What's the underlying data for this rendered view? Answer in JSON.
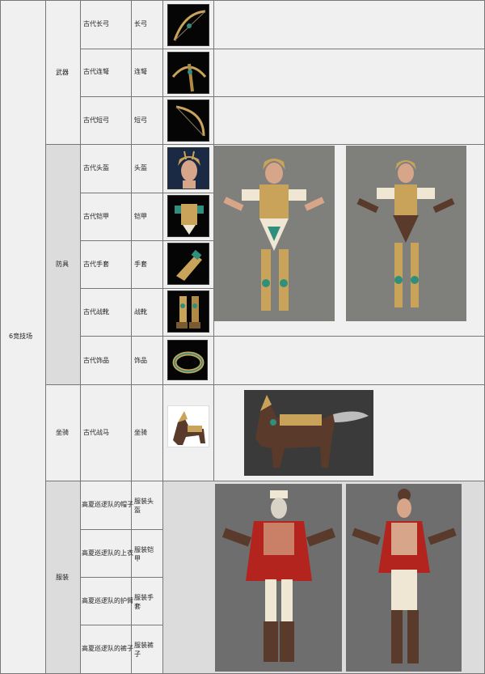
{
  "section": "6竞技场",
  "groups": [
    {
      "label": "武器"
    },
    {
      "label": "防具"
    },
    {
      "label": "坐骑"
    },
    {
      "label": "服装"
    }
  ],
  "rows": [
    {
      "item": "古代长弓",
      "type": "长弓",
      "icon": "longbow-icon"
    },
    {
      "item": "古代连弩",
      "type": "连弩",
      "icon": "crossbow-icon"
    },
    {
      "item": "古代短弓",
      "type": "短弓",
      "icon": "shortbow-icon"
    },
    {
      "item": "古代头盔",
      "type": "头盔",
      "icon": "helmet-icon"
    },
    {
      "item": "古代铠甲",
      "type": "铠甲",
      "icon": "armor-icon"
    },
    {
      "item": "古代手套",
      "type": "手套",
      "icon": "glove-icon"
    },
    {
      "item": "古代战靴",
      "type": "战靴",
      "icon": "boots-icon"
    },
    {
      "item": "古代饰品",
      "type": "饰品",
      "icon": "ring-icon"
    },
    {
      "item": "古代战马",
      "type": "坐骑",
      "icon": "warhorse-icon"
    },
    {
      "item": "高夏巡逻队的帽子",
      "type": "服装头盔"
    },
    {
      "item": "高夏巡逻队的上衣",
      "type": "服装铠甲"
    },
    {
      "item": "高夏巡逻队的护臂",
      "type": "服装手套"
    },
    {
      "item": "高夏巡逻队的裤子",
      "type": "服装裤子"
    }
  ],
  "colors": {
    "gold": "#c9a35a",
    "teal": "#2f8f7c",
    "red": "#b3241f",
    "cream": "#efe6d4"
  }
}
